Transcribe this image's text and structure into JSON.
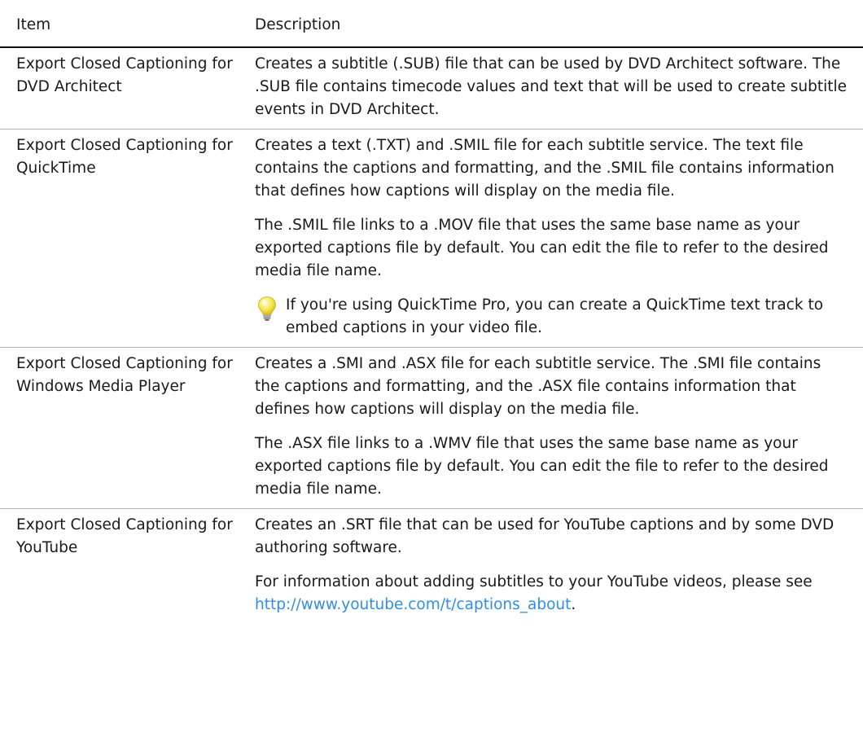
{
  "table": {
    "headers": {
      "item": "Item",
      "description": "Description"
    },
    "rows": [
      {
        "item": "Export Closed Captioning for DVD Architect",
        "paragraphs": [
          "Creates a subtitle (.SUB) file that can be used by DVD Architect software. The .SUB file contains timecode values and text that will be used to create subtitle events in DVD Architect."
        ]
      },
      {
        "item": "Export Closed Captioning for QuickTime",
        "paragraphs": [
          "Creates a text (.TXT) and .SMIL file for each subtitle service. The text file contains the captions and formatting, and the .SMIL file contains information that defines how captions will display on the media file.",
          "The .SMIL file links to a .MOV file that uses the same base name as your exported captions file by default. You can edit the file to refer to the desired media file name."
        ],
        "tip": {
          "icon": "lightbulb-icon",
          "text": "If you're using QuickTime Pro, you can create a QuickTime text track to embed captions in your video file."
        }
      },
      {
        "item": "Export Closed Captioning for Windows Media Player",
        "paragraphs": [
          "Creates a .SMI and .ASX file for each subtitle service. The .SMI file contains the captions and formatting, and the .ASX file contains information that defines how captions will display on the media file.",
          "The .ASX file links to a .WMV file that uses the same base name as your exported captions file by default. You can edit the file to refer to the desired media file name."
        ]
      },
      {
        "item": "Export Closed Captioning for YouTube",
        "paragraphs": [
          "Creates an .SRT file that can be used for YouTube captions and by some DVD authoring software."
        ],
        "link_paragraph": {
          "before": "For information about adding subtitles to your YouTube videos, please see ",
          "link_text": "http://www.youtube.com/t/captions_about",
          "after": "."
        }
      }
    ]
  },
  "colors": {
    "link": "#2e8ee8",
    "header_rule": "#111111",
    "row_rule": "#b3b3b3",
    "bulb": "#f7e64a"
  }
}
